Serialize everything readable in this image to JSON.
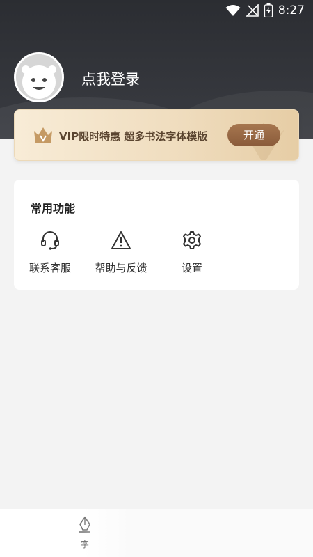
{
  "status_bar": {
    "time": "8:27",
    "icons": [
      "wifi-icon",
      "no-signal-icon",
      "battery-charging-icon"
    ]
  },
  "profile": {
    "login_prompt": "点我登录",
    "avatar_icon": "default-avatar-icon"
  },
  "vip_banner": {
    "icon": "crown-icon",
    "text": "VIP限时特惠 超多书法字体模版",
    "button_label": "开通",
    "accent_color": "#8a5b3a"
  },
  "functions": {
    "title": "常用功能",
    "items": [
      {
        "label": "联系客服",
        "icon": "headset-icon"
      },
      {
        "label": "帮助与反馈",
        "icon": "warning-triangle-icon"
      },
      {
        "label": "设置",
        "icon": "gear-icon"
      }
    ]
  },
  "bottom_nav": {
    "tabs": [
      {
        "label": "字",
        "icon": "pen-nib-icon"
      }
    ]
  }
}
